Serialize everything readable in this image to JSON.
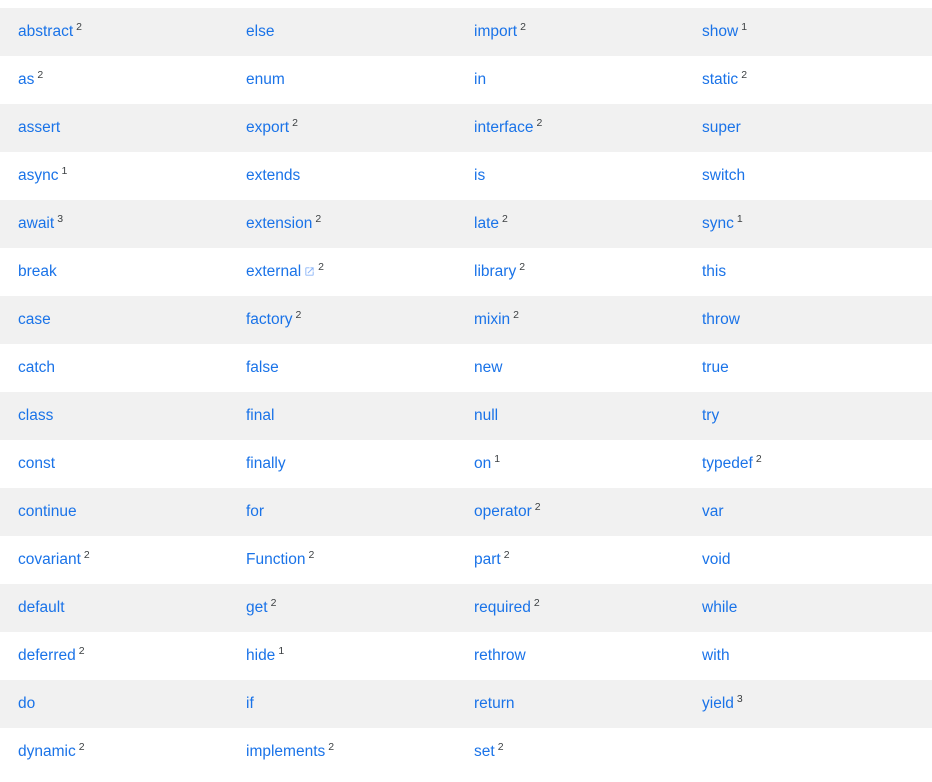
{
  "page": {
    "title": "Dart language keywords table",
    "accent_color": "#1a73e8",
    "shaded_row_color": "#f1f1f1",
    "plain_row_color": "#ffffff",
    "superscript_color": "#3c4043"
  },
  "table": {
    "columns": 4,
    "rows": [
      [
        {
          "label": "abstract",
          "sup": "2"
        },
        {
          "label": "else",
          "sup": ""
        },
        {
          "label": "import",
          "sup": "2"
        },
        {
          "label": "show",
          "sup": "1"
        }
      ],
      [
        {
          "label": "as",
          "sup": "2"
        },
        {
          "label": "enum",
          "sup": ""
        },
        {
          "label": "in",
          "sup": ""
        },
        {
          "label": "static",
          "sup": "2"
        }
      ],
      [
        {
          "label": "assert",
          "sup": ""
        },
        {
          "label": "export",
          "sup": "2"
        },
        {
          "label": "interface",
          "sup": "2"
        },
        {
          "label": "super",
          "sup": ""
        }
      ],
      [
        {
          "label": "async",
          "sup": "1"
        },
        {
          "label": "extends",
          "sup": ""
        },
        {
          "label": "is",
          "sup": ""
        },
        {
          "label": "switch",
          "sup": ""
        }
      ],
      [
        {
          "label": "await",
          "sup": "3"
        },
        {
          "label": "extension",
          "sup": "2"
        },
        {
          "label": "late",
          "sup": "2"
        },
        {
          "label": "sync",
          "sup": "1"
        }
      ],
      [
        {
          "label": "break",
          "sup": ""
        },
        {
          "label": "external",
          "sup": "2",
          "icon": "external-link-icon"
        },
        {
          "label": "library",
          "sup": "2"
        },
        {
          "label": "this",
          "sup": ""
        }
      ],
      [
        {
          "label": "case",
          "sup": ""
        },
        {
          "label": "factory",
          "sup": "2"
        },
        {
          "label": "mixin",
          "sup": "2"
        },
        {
          "label": "throw",
          "sup": ""
        }
      ],
      [
        {
          "label": "catch",
          "sup": ""
        },
        {
          "label": "false",
          "sup": ""
        },
        {
          "label": "new",
          "sup": ""
        },
        {
          "label": "true",
          "sup": ""
        }
      ],
      [
        {
          "label": "class",
          "sup": ""
        },
        {
          "label": "final",
          "sup": ""
        },
        {
          "label": "null",
          "sup": ""
        },
        {
          "label": "try",
          "sup": ""
        }
      ],
      [
        {
          "label": "const",
          "sup": ""
        },
        {
          "label": "finally",
          "sup": ""
        },
        {
          "label": "on",
          "sup": "1"
        },
        {
          "label": "typedef",
          "sup": "2"
        }
      ],
      [
        {
          "label": "continue",
          "sup": ""
        },
        {
          "label": "for",
          "sup": ""
        },
        {
          "label": "operator",
          "sup": "2"
        },
        {
          "label": "var",
          "sup": ""
        }
      ],
      [
        {
          "label": "covariant",
          "sup": "2"
        },
        {
          "label": "Function",
          "sup": "2"
        },
        {
          "label": "part",
          "sup": "2"
        },
        {
          "label": "void",
          "sup": ""
        }
      ],
      [
        {
          "label": "default",
          "sup": ""
        },
        {
          "label": "get",
          "sup": "2"
        },
        {
          "label": "required",
          "sup": "2"
        },
        {
          "label": "while",
          "sup": ""
        }
      ],
      [
        {
          "label": "deferred",
          "sup": "2"
        },
        {
          "label": "hide",
          "sup": "1"
        },
        {
          "label": "rethrow",
          "sup": ""
        },
        {
          "label": "with",
          "sup": ""
        }
      ],
      [
        {
          "label": "do",
          "sup": ""
        },
        {
          "label": "if",
          "sup": ""
        },
        {
          "label": "return",
          "sup": ""
        },
        {
          "label": "yield",
          "sup": "3"
        }
      ],
      [
        {
          "label": "dynamic",
          "sup": "2"
        },
        {
          "label": "implements",
          "sup": "2"
        },
        {
          "label": "set",
          "sup": "2"
        },
        {
          "label": "",
          "sup": ""
        }
      ]
    ]
  }
}
